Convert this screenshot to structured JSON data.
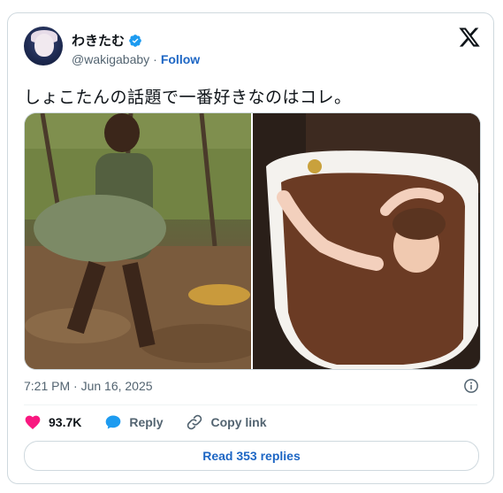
{
  "author": {
    "display_name": "わきたむ",
    "handle": "@wakigababy",
    "separator": "·",
    "follow_label": "Follow"
  },
  "tweet": {
    "text": "しょこたんの話題で一番好きなのはコレ。",
    "timestamp": "7:21 PM · Jun 16, 2025"
  },
  "actions": {
    "like_count": "93.7K",
    "reply_label": "Reply",
    "copy_link_label": "Copy link"
  },
  "read_replies_label": "Read 353 replies",
  "colors": {
    "accent": "#1d66c4",
    "like": "#f91880",
    "verified": "#1d9bf0",
    "text_secondary": "#536471"
  },
  "icons": [
    "verified-badge-icon",
    "x-logo-icon",
    "info-icon",
    "heart-icon",
    "reply-bubble-icon",
    "link-icon"
  ]
}
